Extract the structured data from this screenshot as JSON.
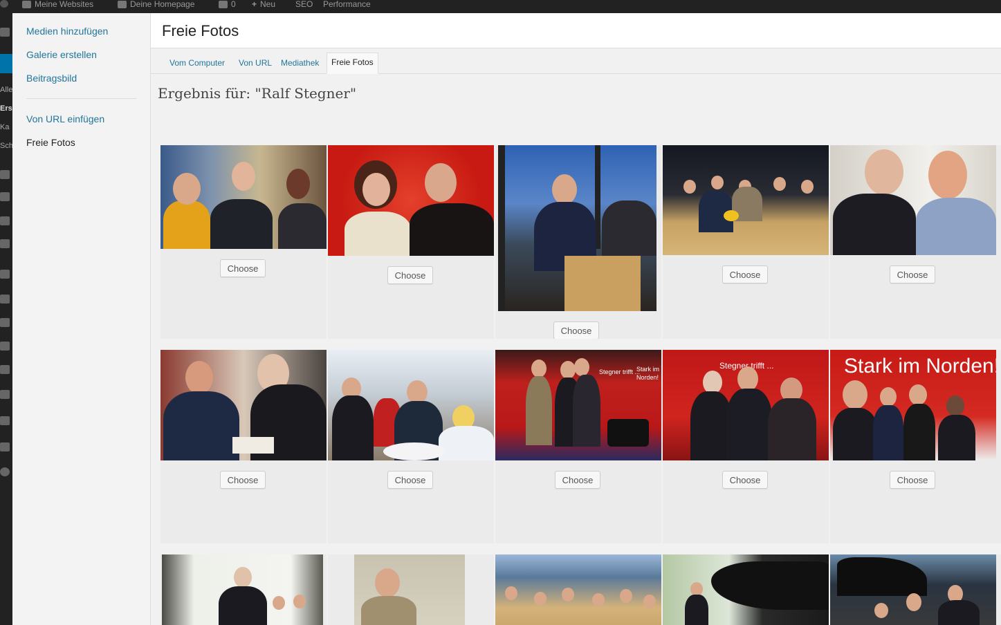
{
  "adminbar": {
    "my_sites": "Meine Websites",
    "homepage": "Deine Homepage",
    "comments": "0",
    "new": "Neu",
    "seo": "SEO",
    "performance": "Performance"
  },
  "adminmenu": {
    "labels": [
      "Alle",
      "Ers",
      "Ka",
      "Sch"
    ]
  },
  "media_sidebar": {
    "items": [
      {
        "label": "Medien hinzufügen"
      },
      {
        "label": "Galerie erstellen"
      },
      {
        "label": "Beitragsbild"
      },
      {
        "label": "Von URL einfügen"
      },
      {
        "label": "Freie Fotos"
      }
    ]
  },
  "frame": {
    "title": "Freie Fotos"
  },
  "tabs": [
    {
      "label": "Vom Computer"
    },
    {
      "label": "Von URL"
    },
    {
      "label": "Mediathek"
    },
    {
      "label": "Freie Fotos"
    }
  ],
  "results": {
    "heading": "Ergebnis für: \"Ralf Stegner\"",
    "choose_label": "Choose",
    "photo_captions": [
      "Stark im Norden!",
      "Stegner trifft ..."
    ]
  },
  "colors": {
    "link": "#21759b",
    "admin_bar": "#222222",
    "sidebar_bg": "#f3f3f3",
    "content_bg": "#f1f1f1",
    "tile_bg": "#ebebeb"
  }
}
